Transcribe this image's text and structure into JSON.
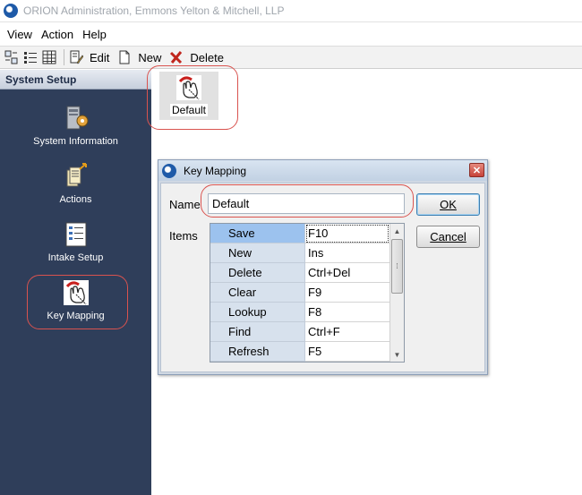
{
  "window": {
    "title": "ORION Administration, Emmons Yelton & Mitchell, LLP"
  },
  "menu": {
    "items": [
      "View",
      "Action",
      "Help"
    ]
  },
  "toolbar": {
    "edit_label": "Edit",
    "new_label": "New",
    "delete_label": "Delete"
  },
  "sidebar": {
    "header": "System Setup",
    "items": [
      {
        "label": "System Information",
        "icon": "system-information-icon"
      },
      {
        "label": "Actions",
        "icon": "actions-icon"
      },
      {
        "label": "Intake Setup",
        "icon": "intake-setup-icon"
      },
      {
        "label": "Key Mapping",
        "icon": "key-mapping-icon"
      }
    ]
  },
  "content": {
    "tile_label": "Default"
  },
  "dialog": {
    "title": "Key Mapping",
    "name_label": "Name",
    "name_value": "Default",
    "items_label": "Items",
    "ok_label": "OK",
    "cancel_label": "Cancel",
    "rows": [
      {
        "action": "Save",
        "key": "F10"
      },
      {
        "action": "New",
        "key": "Ins"
      },
      {
        "action": "Delete",
        "key": "Ctrl+Del"
      },
      {
        "action": "Clear",
        "key": "F9"
      },
      {
        "action": "Lookup",
        "key": "F8"
      },
      {
        "action": "Find",
        "key": "Ctrl+F"
      },
      {
        "action": "Refresh",
        "key": "F5"
      }
    ]
  },
  "colors": {
    "sidebar_bg": "#2f3e5a",
    "selection": "#9cc2ee",
    "callout": "#d9534f"
  }
}
